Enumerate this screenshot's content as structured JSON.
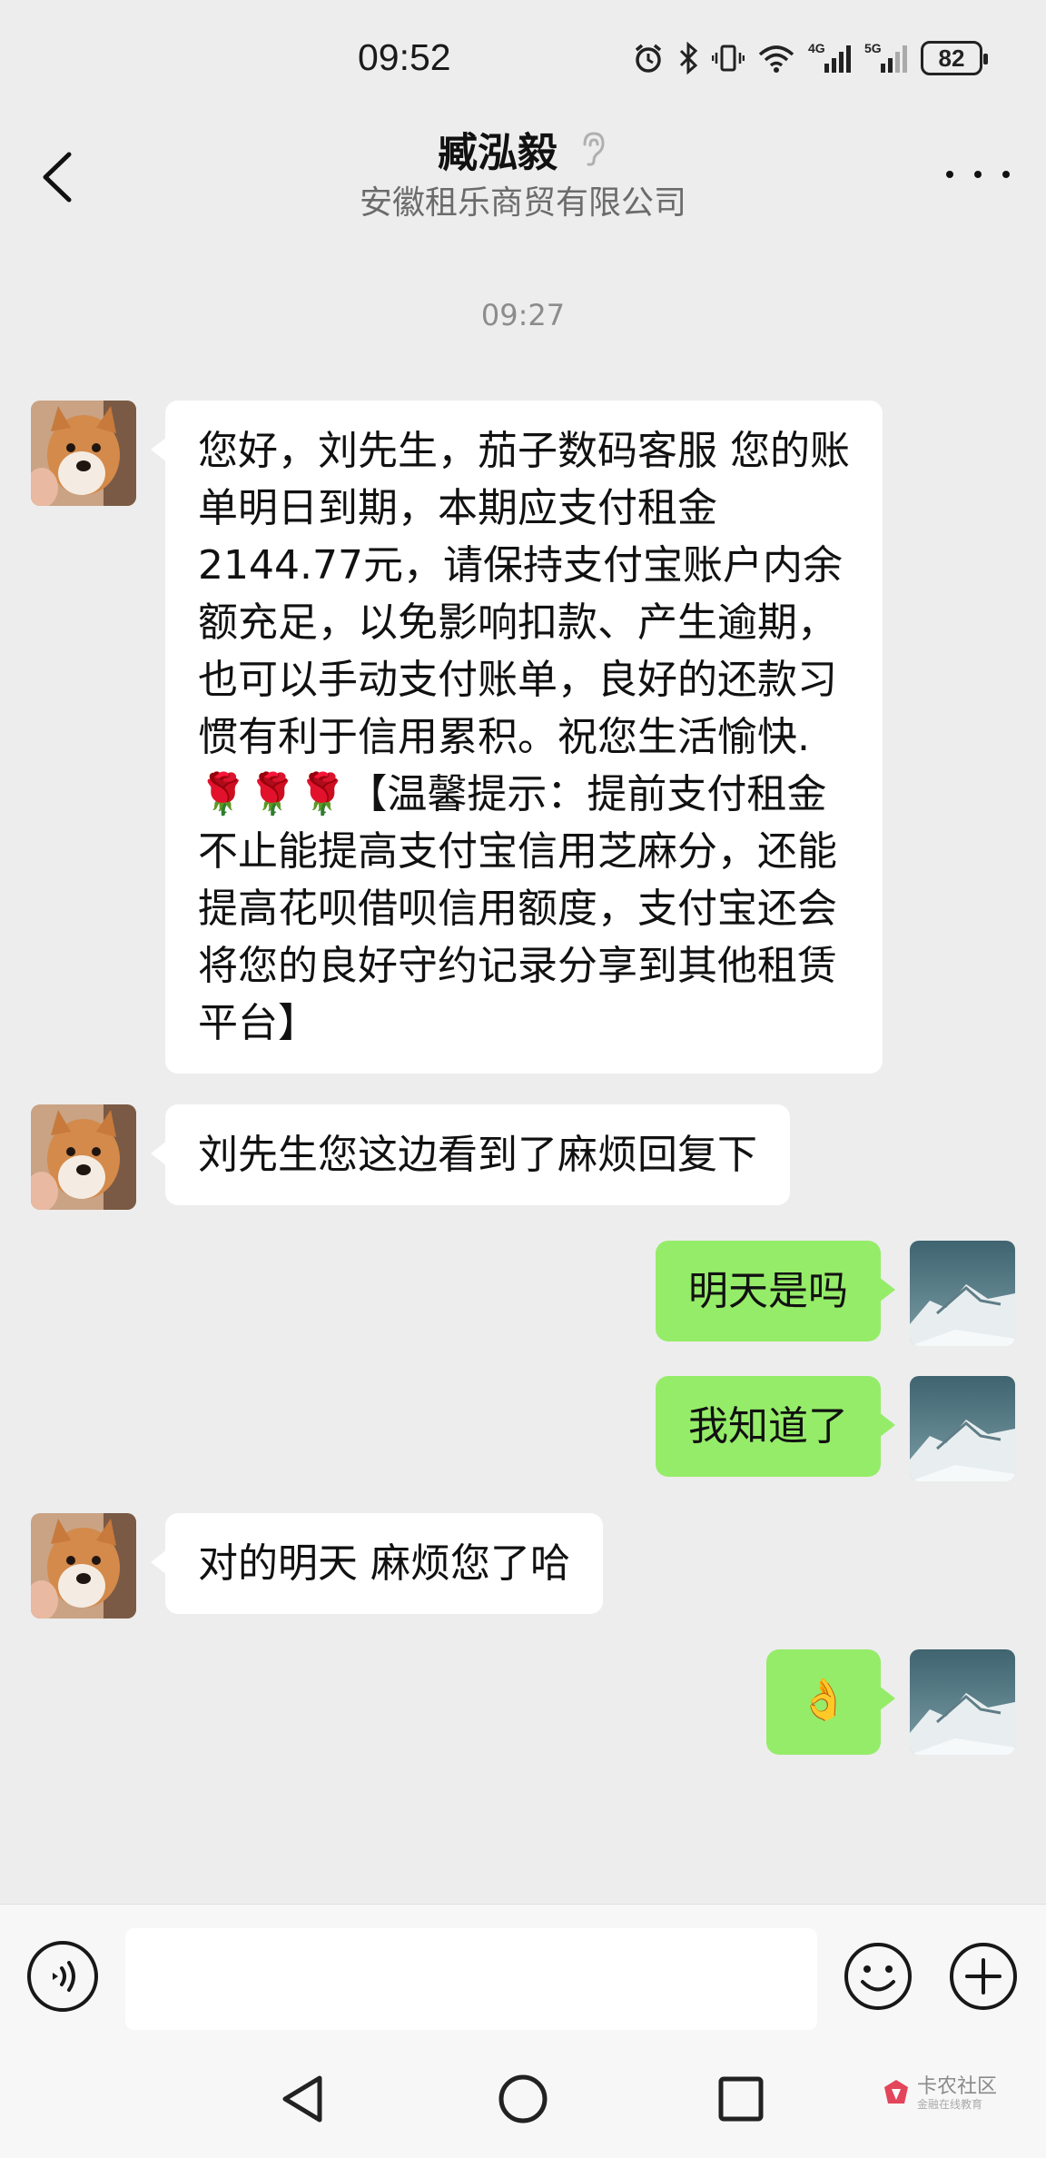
{
  "status_bar": {
    "time": "09:52",
    "network_4g": "4G",
    "network_5g": "5G",
    "battery": "82",
    "icons": [
      "alarm-icon",
      "bluetooth-icon",
      "vibrate-icon",
      "wifi-icon",
      "signal-4g-icon",
      "signal-5g-icon",
      "battery-icon"
    ]
  },
  "header": {
    "title": "臧泓毅",
    "subtitle": "安徽租乐商贸有限公司",
    "back_icon": "chevron-left-icon",
    "ear_icon": "ear-icon",
    "more_icon": "more-icon"
  },
  "chat": {
    "timestamp": "09:27",
    "messages": [
      {
        "side": "left",
        "text": "您好，刘先生，茄子数码客服  您的账单明日到期，本期应支付租金2144.77元，请保持支付宝账户内余额充足，以免影响扣款、产生逾期，也可以手动支付账单，良好的还款习惯有利于信用累积。祝您生活愉快.🌹🌹🌹【温馨提示：提前支付租金不止能提高支付宝信用芝麻分，还能提高花呗借呗信用额度，支付宝还会将您的良好守约记录分享到其他租赁平台】"
      },
      {
        "side": "left",
        "text": "刘先生您这边看到了麻烦回复下"
      },
      {
        "side": "right",
        "text": "明天是吗"
      },
      {
        "side": "right",
        "text": "我知道了"
      },
      {
        "side": "left",
        "text": "对的明天 麻烦您了哈"
      },
      {
        "side": "right",
        "text": "👌"
      }
    ]
  },
  "input_bar": {
    "voice_icon": "voice-icon",
    "emoji_icon": "emoji-icon",
    "plus_icon": "plus-icon",
    "input_value": ""
  },
  "system_nav": {
    "back_icon": "triangle-back-icon",
    "home_icon": "circle-home-icon",
    "recents_icon": "square-recents-icon"
  },
  "watermark": {
    "name": "卡农社区",
    "tagline": "金融在线教育"
  },
  "colors": {
    "background": "#ededed",
    "bubble_left": "#ffffff",
    "bubble_right": "#95ec69"
  }
}
